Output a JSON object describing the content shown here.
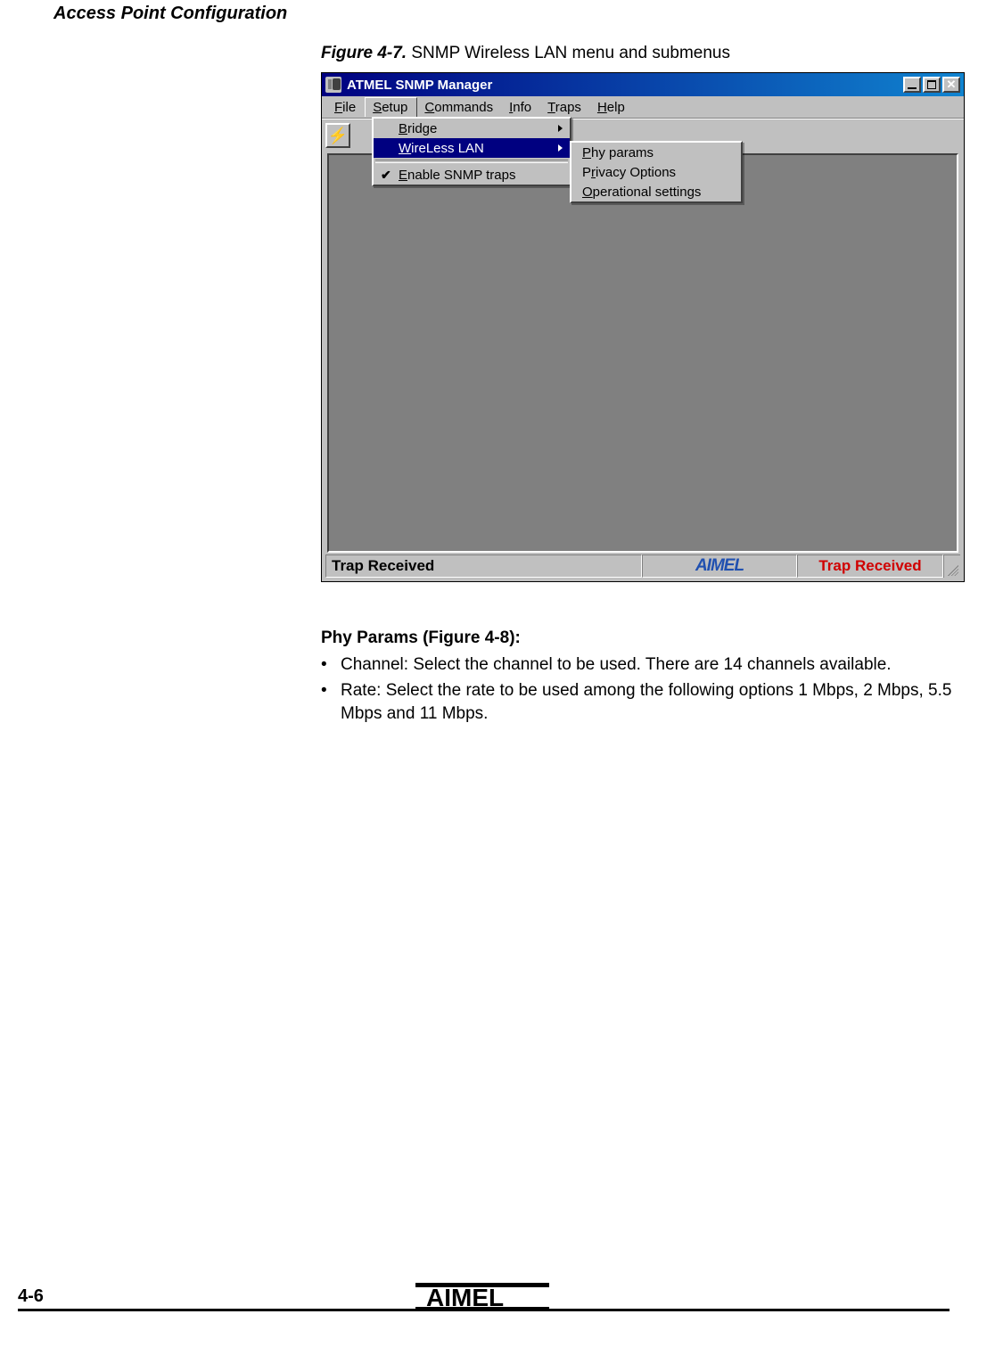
{
  "header": "Access Point Configuration",
  "figure_caption_label": "Figure 4-7.",
  "figure_caption_text": "  SNMP Wireless LAN menu and submenus",
  "window": {
    "title": "ATMEL SNMP Manager",
    "menubar": [
      "File",
      "Setup",
      "Commands",
      "Info",
      "Traps",
      "Help"
    ],
    "setup_menu": {
      "bridge": "Bridge",
      "wireless": "WireLess LAN",
      "enable": "Enable SNMP traps"
    },
    "wireless_submenu": {
      "phy": "Phy params",
      "privacy": "Privacy Options",
      "ops": "Operational settings"
    },
    "status_left": "Trap Received",
    "status_logo": "AIMEL",
    "status_right": "Trap Received"
  },
  "body": {
    "heading": "Phy Params (Figure 4-8):",
    "bullet1": "Channel: Select the channel to be used. There are 14 channels available.",
    "bullet2": "Rate: Select the rate to be used among the following options 1 Mbps, 2 Mbps, 5.5 Mbps and 11 Mbps."
  },
  "page_number": "4-6"
}
